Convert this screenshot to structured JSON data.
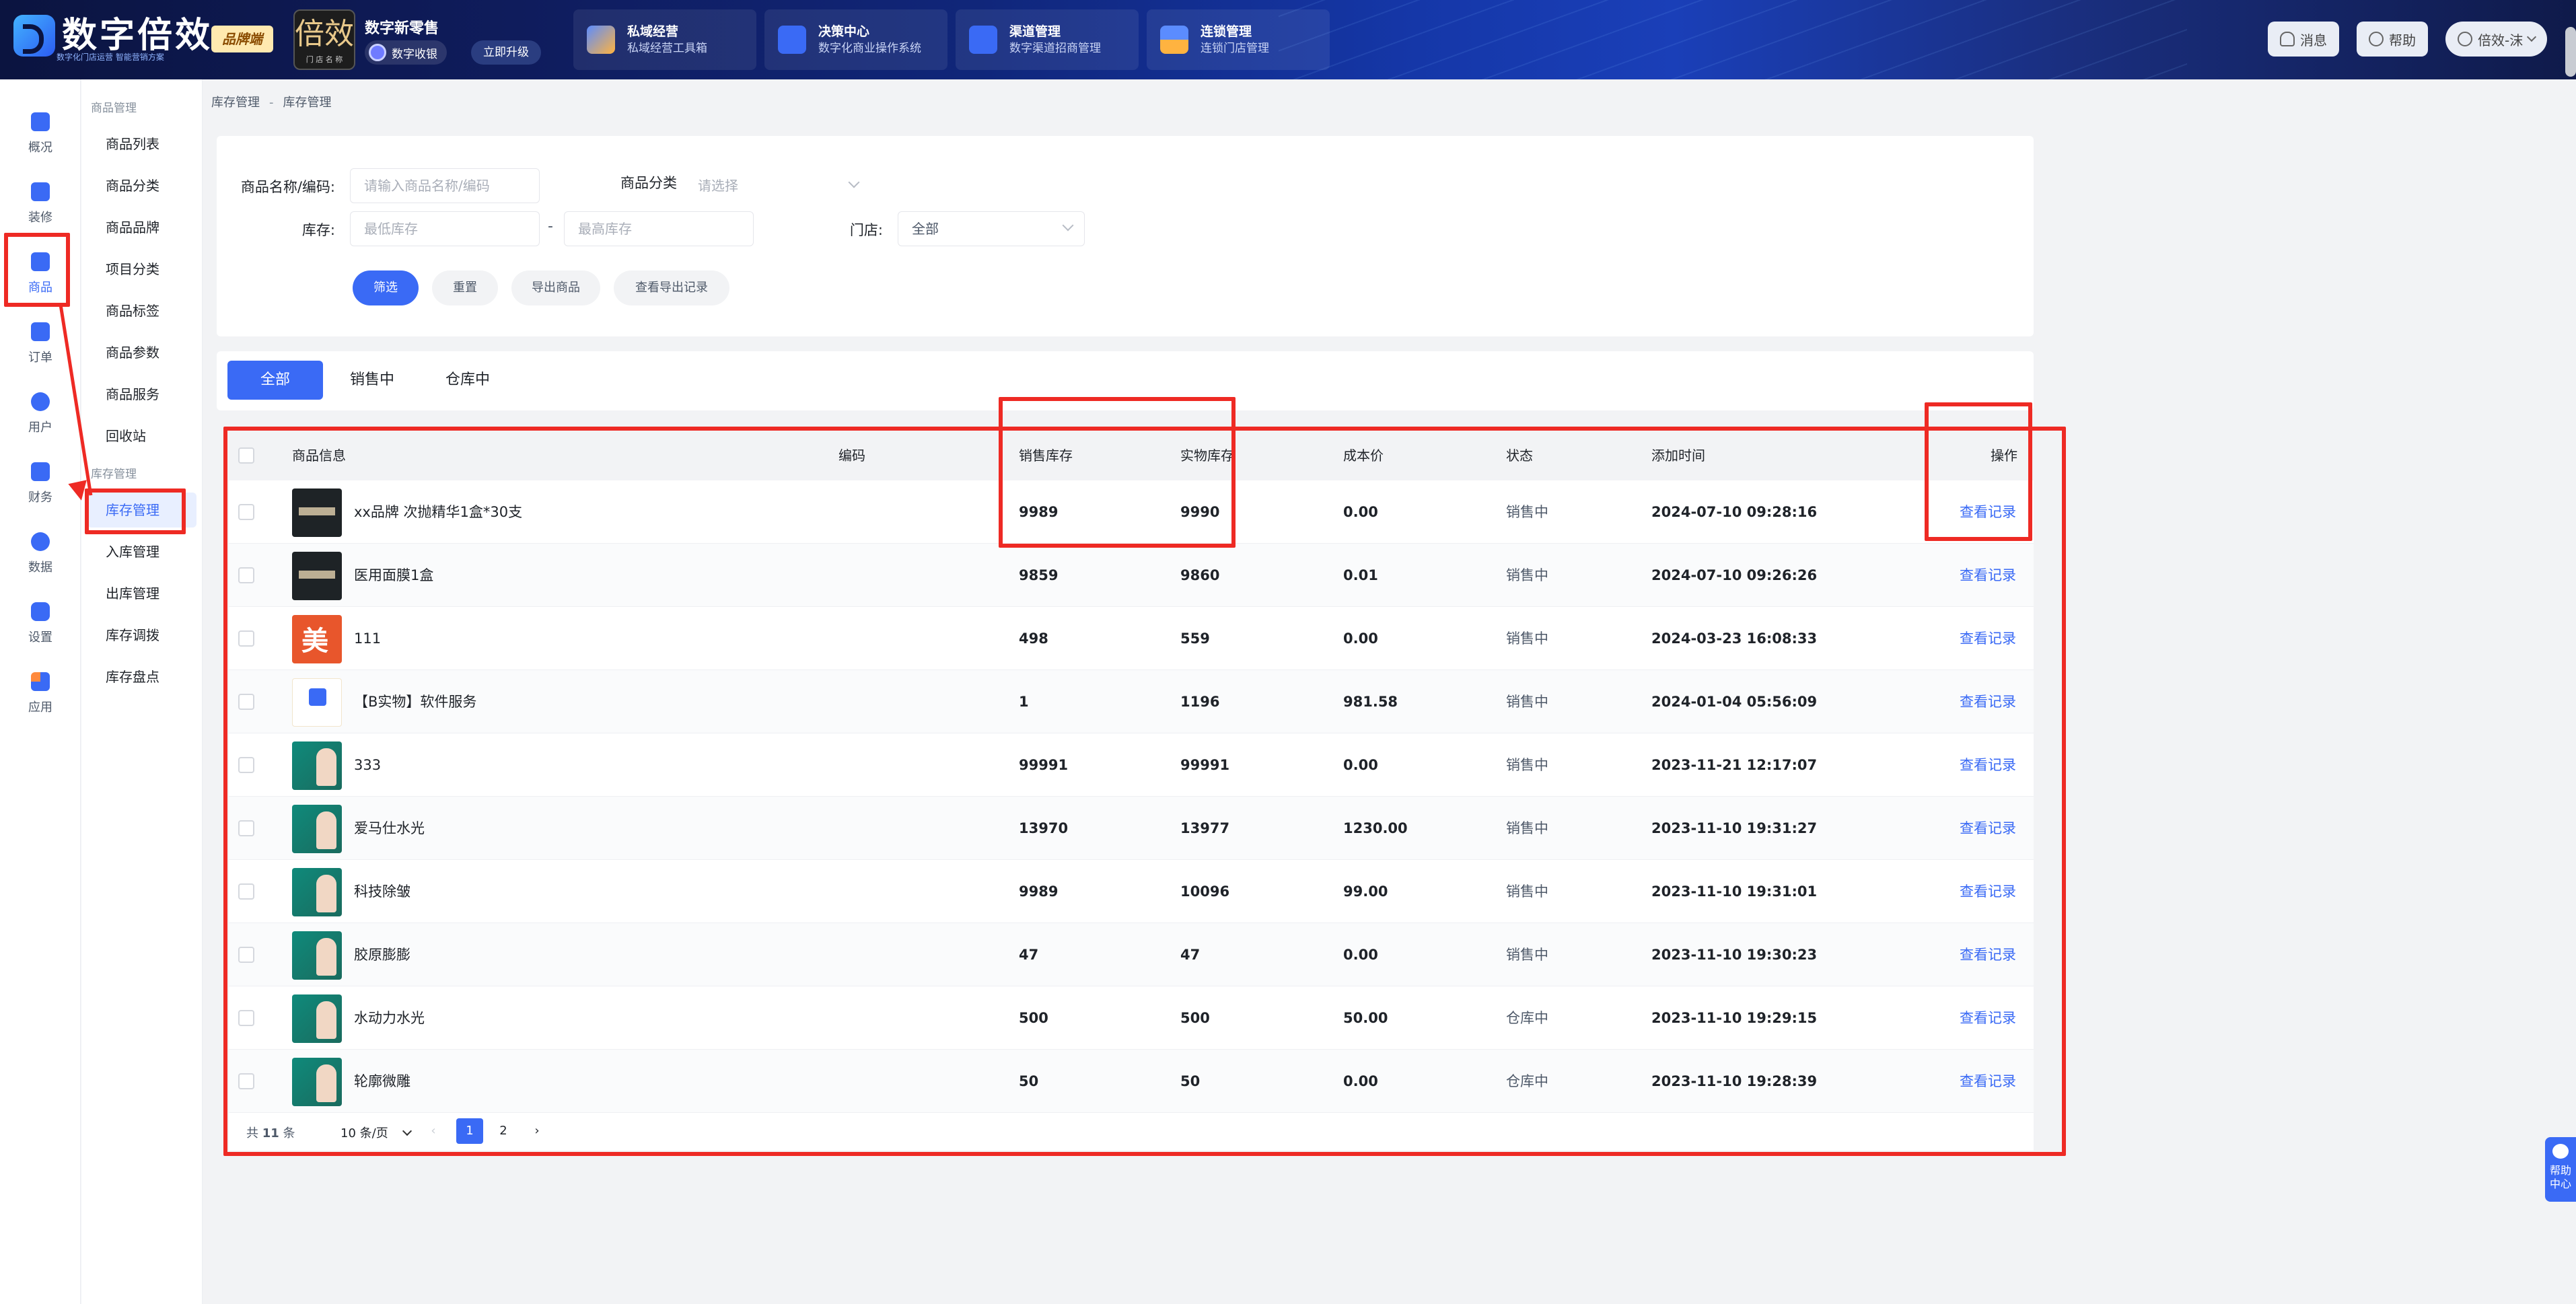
{
  "header": {
    "logo_text": "数字倍效",
    "logo_sub": "数字化门店运营 智能营销方案",
    "brand_badge": "品牌端",
    "store_thumb_text": "倍效",
    "store_thumb_sub": "门 店 名 称",
    "store_name": "数字新零售",
    "store_tag": "数字收银",
    "upgrade_label": "立即升级",
    "modules": [
      {
        "title": "私域经营",
        "subtitle": "私域经营工具箱"
      },
      {
        "title": "决策中心",
        "subtitle": "数字化商业操作系统"
      },
      {
        "title": "渠道管理",
        "subtitle": "数字渠道招商管理"
      },
      {
        "title": "连锁管理",
        "subtitle": "连锁门店管理"
      }
    ],
    "message_label": "消息",
    "help_label": "帮助",
    "user_label": "倍效-沫"
  },
  "rail": [
    {
      "label": "概况"
    },
    {
      "label": "装修"
    },
    {
      "label": "商品"
    },
    {
      "label": "订单"
    },
    {
      "label": "用户"
    },
    {
      "label": "财务"
    },
    {
      "label": "数据"
    },
    {
      "label": "设置"
    },
    {
      "label": "应用"
    }
  ],
  "submenu": {
    "group1": "商品管理",
    "group1_items": [
      "商品列表",
      "商品分类",
      "商品品牌",
      "项目分类",
      "商品标签",
      "商品参数",
      "商品服务",
      "回收站"
    ],
    "group2": "库存管理",
    "group2_items": [
      "库存管理",
      "入库管理",
      "出库管理",
      "库存调拨",
      "库存盘点"
    ]
  },
  "breadcrumb": [
    "库存管理",
    "库存管理"
  ],
  "filter": {
    "name_label": "商品名称/编码:",
    "name_placeholder": "请输入商品名称/编码",
    "category_label": "商品分类",
    "category_placeholder": "请选择",
    "stock_label": "库存:",
    "stock_min_placeholder": "最低库存",
    "stock_dash": "-",
    "stock_max_placeholder": "最高库存",
    "store_label": "门店:",
    "store_value": "全部",
    "btn_filter": "筛选",
    "btn_reset": "重置",
    "btn_export": "导出商品",
    "btn_export_log": "查看导出记录"
  },
  "tabs": [
    "全部",
    "销售中",
    "仓库中"
  ],
  "table": {
    "columns": [
      "商品信息",
      "编码",
      "销售库存",
      "实物库存",
      "成本价",
      "状态",
      "添加时间",
      "操作"
    ],
    "rows": [
      {
        "name": "xx品牌 次抛精华1盒*30支",
        "code": "",
        "sale_stock": "9989",
        "real_stock": "9990",
        "cost": "0.00",
        "status": "销售中",
        "time": "2024-07-10 09:28:16",
        "action": "查看记录",
        "thumb": "dark"
      },
      {
        "name": "医用面膜1盒",
        "code": "",
        "sale_stock": "9859",
        "real_stock": "9860",
        "cost": "0.01",
        "status": "销售中",
        "time": "2024-07-10 09:26:26",
        "action": "查看记录",
        "thumb": "dark"
      },
      {
        "name": "111",
        "code": "",
        "sale_stock": "498",
        "real_stock": "559",
        "cost": "0.00",
        "status": "销售中",
        "time": "2024-03-23 16:08:33",
        "action": "查看记录",
        "thumb": "red"
      },
      {
        "name": "【B实物】软件服务",
        "code": "",
        "sale_stock": "1",
        "real_stock": "1196",
        "cost": "981.58",
        "status": "销售中",
        "time": "2024-01-04 05:56:09",
        "action": "查看记录",
        "thumb": "white"
      },
      {
        "name": "333",
        "code": "",
        "sale_stock": "99991",
        "real_stock": "99991",
        "cost": "0.00",
        "status": "销售中",
        "time": "2023-11-21 12:17:07",
        "action": "查看记录",
        "thumb": "green"
      },
      {
        "name": "爱马仕水光",
        "code": "",
        "sale_stock": "13970",
        "real_stock": "13977",
        "cost": "1230.00",
        "status": "销售中",
        "time": "2023-11-10 19:31:27",
        "action": "查看记录",
        "thumb": "green"
      },
      {
        "name": "科技除皱",
        "code": "",
        "sale_stock": "9989",
        "real_stock": "10096",
        "cost": "99.00",
        "status": "销售中",
        "time": "2023-11-10 19:31:01",
        "action": "查看记录",
        "thumb": "green"
      },
      {
        "name": "胶原膨膨",
        "code": "",
        "sale_stock": "47",
        "real_stock": "47",
        "cost": "0.00",
        "status": "销售中",
        "time": "2023-11-10 19:30:23",
        "action": "查看记录",
        "thumb": "green"
      },
      {
        "name": "水动力水光",
        "code": "",
        "sale_stock": "500",
        "real_stock": "500",
        "cost": "50.00",
        "status": "仓库中",
        "time": "2023-11-10 19:29:15",
        "action": "查看记录",
        "thumb": "green"
      },
      {
        "name": "轮廓微雕",
        "code": "",
        "sale_stock": "50",
        "real_stock": "50",
        "cost": "0.00",
        "status": "仓库中",
        "time": "2023-11-10 19:28:39",
        "action": "查看记录",
        "thumb": "green"
      }
    ]
  },
  "pagination": {
    "total_prefix": "共",
    "total": "11",
    "total_suffix": "条",
    "page_size": "10 条/页",
    "pages": [
      "1",
      "2"
    ],
    "current": "1"
  },
  "help_center": "帮助中心",
  "colors": {
    "accent": "#3a6af5",
    "annotation": "#ee2a24"
  }
}
